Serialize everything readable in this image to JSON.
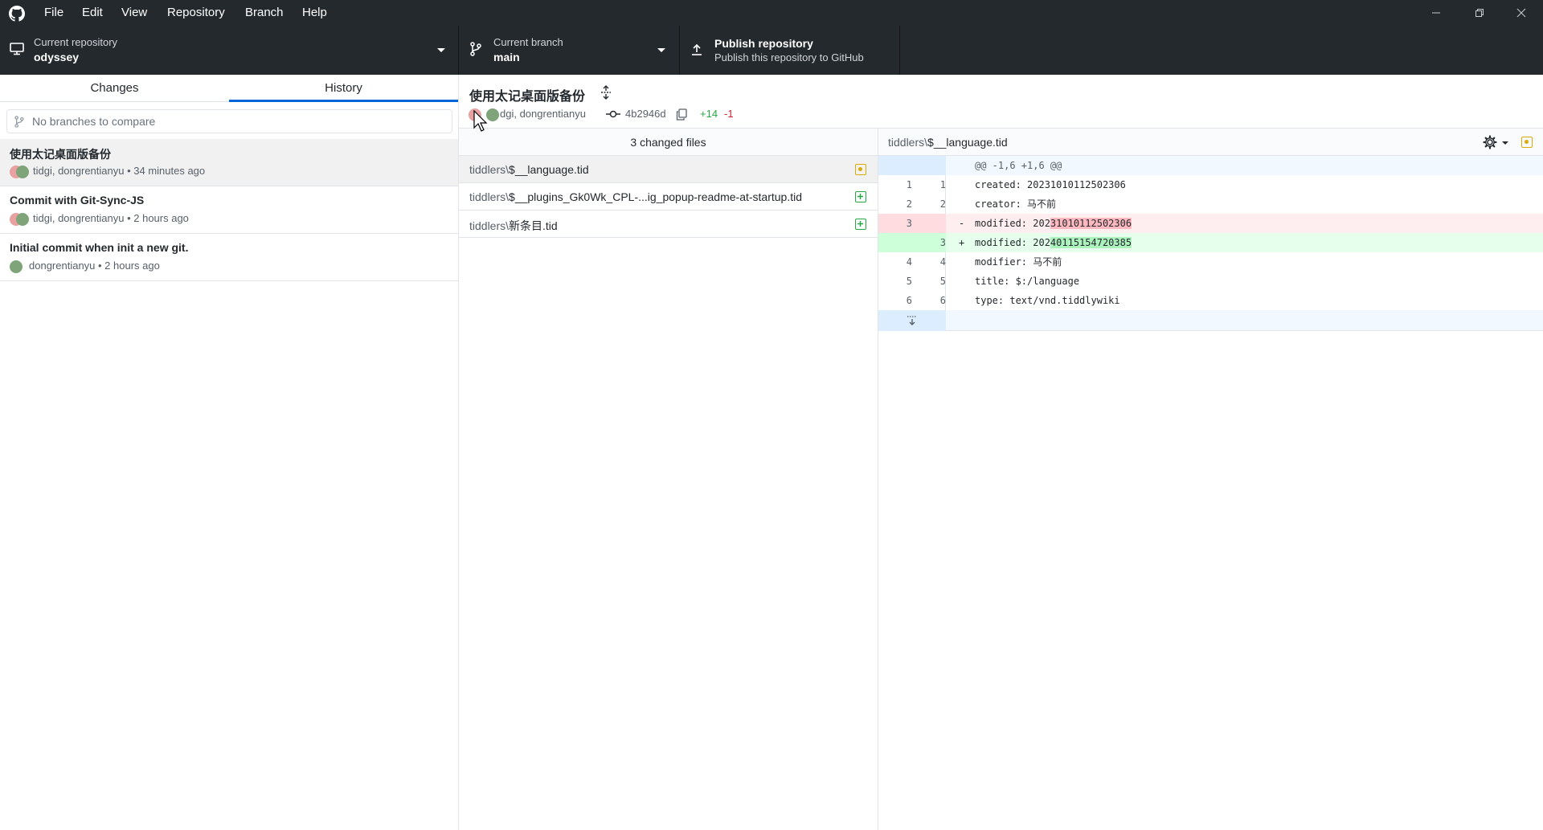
{
  "titlebar": {
    "menus": [
      "File",
      "Edit",
      "View",
      "Repository",
      "Branch",
      "Help"
    ],
    "window_controls": [
      "minimize-icon",
      "restore-icon",
      "close-icon"
    ]
  },
  "toolbar": {
    "repo_label": "Current repository",
    "repo_value": "odyssey",
    "branch_label": "Current branch",
    "branch_value": "main",
    "publish_title": "Publish repository",
    "publish_subtitle": "Publish this repository to GitHub"
  },
  "sidebar": {
    "tabs": [
      "Changes",
      "History"
    ],
    "active_tab": "History",
    "compare_placeholder": "No branches to compare",
    "commits": [
      {
        "title": "使用太记桌面版备份",
        "meta": "tidgi, dongrentianyu • 34 minutes ago"
      },
      {
        "title": "Commit with Git-Sync-JS",
        "meta": "tidgi, dongrentianyu • 2 hours ago"
      },
      {
        "title": "Initial commit when init a new git.",
        "meta": "dongrentianyu • 2 hours ago"
      }
    ]
  },
  "commit": {
    "title": "使用太记桌面版备份",
    "authors": "dgi, dongrentianyu",
    "sha": "4b2946d",
    "additions": "+14",
    "deletions": "-1"
  },
  "files": {
    "header": "3 changed files",
    "items": [
      {
        "dir": "tiddlers\\",
        "name": "$__language.tid",
        "status": "modified"
      },
      {
        "dir": "tiddlers\\",
        "name": "$__plugins_Gk0Wk_CPL-...ig_popup-readme-at-startup.tid",
        "status": "added"
      },
      {
        "dir": "tiddlers\\",
        "name": "新条目.tid",
        "status": "added"
      }
    ]
  },
  "diff": {
    "file_dir": "tiddlers\\",
    "file_name": "$__language.tid",
    "hunk_header": "@@ -1,6 +1,6 @@",
    "lines": [
      {
        "old": "1",
        "new": "1",
        "mark": "",
        "text": "created: 20231010112502306",
        "type": "context"
      },
      {
        "old": "2",
        "new": "2",
        "mark": "",
        "text": "creator: 马不前",
        "type": "context"
      },
      {
        "old": "3",
        "new": "",
        "mark": "-",
        "prefix": "modified: 202",
        "hl": "31010112502306",
        "type": "deleted"
      },
      {
        "old": "",
        "new": "3",
        "mark": "+",
        "prefix": "modified: 202",
        "hl": "40115154720385",
        "type": "added"
      },
      {
        "old": "4",
        "new": "4",
        "mark": "",
        "text": "modifier: 马不前",
        "type": "context"
      },
      {
        "old": "5",
        "new": "5",
        "mark": "",
        "text": "title: $:/language",
        "type": "context"
      },
      {
        "old": "6",
        "new": "6",
        "mark": "",
        "text": "type: text/vnd.tiddlywiki",
        "type": "context"
      }
    ]
  },
  "colors": {
    "chrome_dark": "#24292e",
    "accent_blue": "#0366d6",
    "added_green": "#28a745",
    "deleted_red": "#cb2431",
    "modified_amber": "#dbab09"
  }
}
